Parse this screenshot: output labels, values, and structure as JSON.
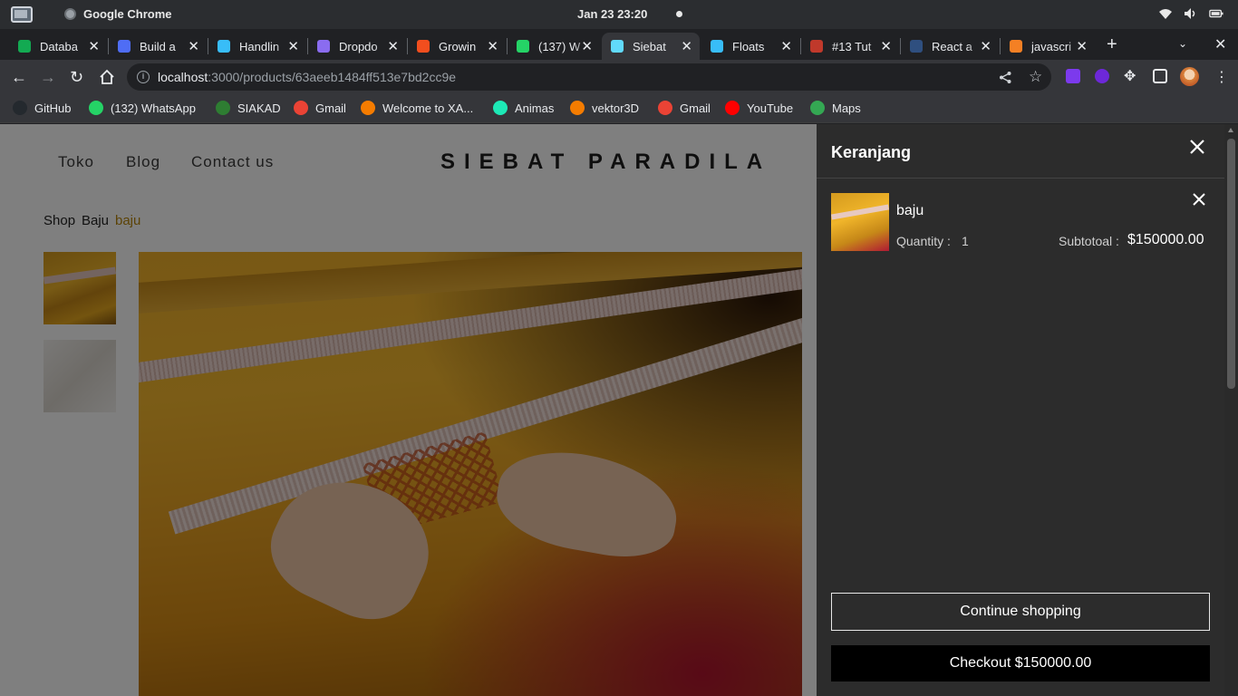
{
  "os": {
    "app_name": "Google Chrome",
    "clock": "Jan 23  23:20"
  },
  "tabs": [
    {
      "title": "Databa",
      "color": "#13aa52"
    },
    {
      "title": "Build a",
      "color": "#4f6df5"
    },
    {
      "title": "Handlin",
      "color": "#38bdf8"
    },
    {
      "title": "Dropdo",
      "color": "#8a6cf0"
    },
    {
      "title": "Growin",
      "color": "#f24e1e"
    },
    {
      "title": "(137) W",
      "color": "#25d366"
    },
    {
      "title": "Siebat",
      "color": "#61dafb"
    },
    {
      "title": "Floats",
      "color": "#38bdf8"
    },
    {
      "title": "#13 Tut",
      "color": "#c0392b"
    },
    {
      "title": "React a",
      "color": "#2f4f7f"
    },
    {
      "title": "javascri",
      "color": "#f48024"
    }
  ],
  "toolbar": {
    "url_host": "localhost",
    "url_path": ":3000/products/63aeeb1484ff513e7bd2cc9e"
  },
  "bookmarks": [
    {
      "label": "GitHub",
      "color": "#24292e"
    },
    {
      "label": "(132) WhatsApp",
      "color": "#25d366"
    },
    {
      "label": "SIAKAD",
      "color": "#2e7d32"
    },
    {
      "label": "Gmail",
      "color": "#ea4335"
    },
    {
      "label": "Welcome to XA...",
      "color": "#f57c00"
    },
    {
      "label": "Animas",
      "color": "#1de9b6"
    },
    {
      "label": "vektor3D",
      "color": "#f57c00"
    },
    {
      "label": "Gmail",
      "color": "#ea4335"
    },
    {
      "label": "YouTube",
      "color": "#ff0000"
    },
    {
      "label": "Maps",
      "color": "#34a853"
    }
  ],
  "site": {
    "nav": [
      "Toko",
      "Blog",
      "Contact us"
    ],
    "brand": "SIEBAT PARADILA",
    "breadcrumb": [
      "Shop",
      "Baju",
      "baju"
    ]
  },
  "cart": {
    "title": "Keranjang",
    "item": {
      "name": "baju",
      "quantity_label": "Quantity :",
      "quantity": "1",
      "subtotal_label": "Subtotoal :",
      "subtotal": "$150000.00"
    },
    "continue_label": "Continue shopping",
    "checkout_label": "Checkout $150000.00"
  }
}
